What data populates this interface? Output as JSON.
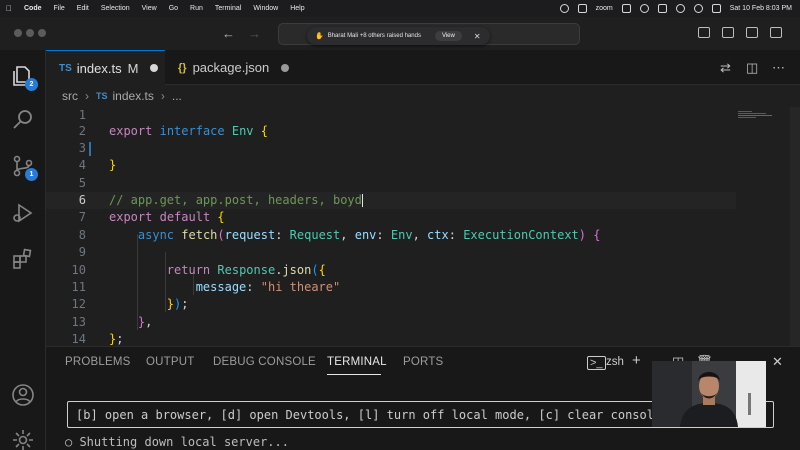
{
  "menubar": {
    "app": "Code",
    "items": [
      "File",
      "Edit",
      "Selection",
      "View",
      "Go",
      "Run",
      "Terminal",
      "Window",
      "Help"
    ],
    "zoom_label": "zoom",
    "datetime": "Sat 10 Feb  8:03 PM"
  },
  "notification": {
    "text": "Bharat Mali +8 others raised hands",
    "view_label": "View"
  },
  "tabs": [
    {
      "icon": "TS",
      "name": "index.ts",
      "status": "M"
    },
    {
      "icon": "{}",
      "name": "package.json",
      "status": ""
    }
  ],
  "breadcrumb": {
    "folder": "src",
    "icon": "TS",
    "file": "index.ts",
    "more": "..."
  },
  "editor": {
    "line_numbers": [
      "1",
      "2",
      "3",
      "4",
      "5",
      "6",
      "7",
      "8",
      "9",
      "10",
      "11",
      "12",
      "13",
      "14"
    ],
    "current_line": "6"
  },
  "panel": {
    "tabs": [
      "PROBLEMS",
      "OUTPUT",
      "DEBUG CONSOLE",
      "TERMINAL",
      "PORTS"
    ],
    "active_tab": "TERMINAL",
    "shell": "zsh",
    "terminal_hint": "[b] open a browser, [d] open Devtools, [l] turn off local mode, [c] clear console, [x]",
    "terminal_status": "○ Shutting down local server..."
  },
  "activity": {
    "explorer_badge": "2",
    "scm_badge": "1"
  },
  "colors": {
    "accent": "#0078d4",
    "badge": "#2a7bd6",
    "keyword": "#3b8ed0",
    "type": "#4ec9b0",
    "string": "#ce9178",
    "comment": "#6a9955"
  }
}
